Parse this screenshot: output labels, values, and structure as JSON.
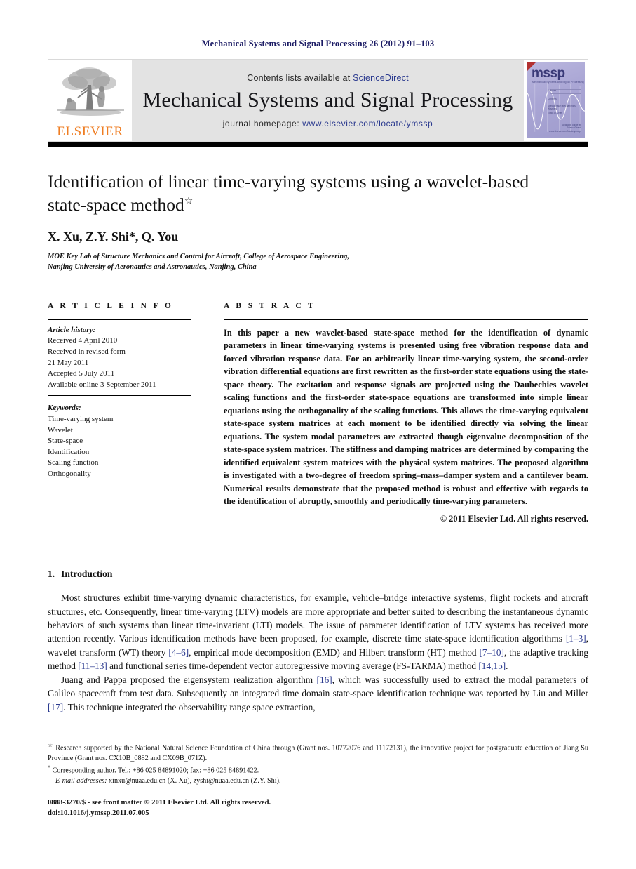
{
  "running_head": "Mechanical Systems and Signal Processing 26 (2012) 91–103",
  "masthead": {
    "publisher_logo_label": "ELSEVIER",
    "contents_prefix": "Contents lists available at",
    "contents_link": "ScienceDirect",
    "journal_title": "Mechanical Systems and Signal Processing",
    "homepage_prefix": "journal homepage:",
    "homepage_url": "www.elsevier.com/locate/ymssp",
    "cover": {
      "acronym": "mssp",
      "subtitle": "Mechanical Systems and Signal Processing",
      "line1": "Volumes",
      "line2": "Contents",
      "line3": "Special Issue: Mechatronics, Wavelets",
      "line4": "Editor-in-Chief",
      "footer1": "Available online at",
      "footer2": "ScienceDirect",
      "footer3": "www.elsevier.com/locate/ymssp"
    }
  },
  "article": {
    "title": "Identification of linear time-varying systems using a wavelet-based state-space method",
    "title_footnote_mark": "☆",
    "authors": "X. Xu, Z.Y. Shi*, Q. You",
    "affiliation_line1": "MOE Key Lab of Structure Mechanics and Control for Aircraft, College of Aerospace Engineering,",
    "affiliation_line2": "Nanjing University of Aeronautics and Astronautics, Nanjing, China"
  },
  "article_info": {
    "heading": "A R T I C L E   I N F O",
    "history_label": "Article history:",
    "history": [
      "Received 4 April 2010",
      "Received in revised form",
      "21 May 2011",
      "Accepted 5 July 2011",
      "Available online 3 September 2011"
    ],
    "keywords_label": "Keywords:",
    "keywords": [
      "Time-varying system",
      "Wavelet",
      "State-space",
      "Identification",
      "Scaling function",
      "Orthogonality"
    ]
  },
  "abstract": {
    "heading": "A B S T R A C T",
    "text": "In this paper a new wavelet-based state-space method for the identification of dynamic parameters in linear time-varying systems is presented using free vibration response data and forced vibration response data. For an arbitrarily linear time-varying system, the second-order vibration differential equations are first rewritten as the first-order state equations using the state-space theory. The excitation and response signals are projected using the Daubechies wavelet scaling functions and the first-order state-space equations are transformed into simple linear equations using the orthogonality of the scaling functions. This allows the time-varying equivalent state-space system matrices at each moment to be identified directly via solving the linear equations. The system modal parameters are extracted though eigenvalue decomposition of the state-space system matrices. The stiffness and damping matrices are determined by comparing the identified equivalent system matrices with the physical system matrices. The proposed algorithm is investigated with a two-degree of freedom spring–mass–damper system and a cantilever beam. Numerical results demonstrate that the proposed method is robust and effective with regards to the identification of abruptly, smoothly and periodically time-varying parameters.",
    "copyright": "© 2011 Elsevier Ltd. All rights reserved."
  },
  "body": {
    "section_number": "1.",
    "section_title": "Introduction",
    "para1_a": "Most structures exhibit time-varying dynamic characteristics, for example, vehicle–bridge interactive systems, flight rockets and aircraft structures, etc. Consequently, linear time-varying (LTV) models are more appropriate and better suited to describing the instantaneous dynamic behaviors of such systems than linear time-invariant (LTI) models. The issue of parameter identification of LTV systems has received more attention recently. Various identification methods have been proposed, for example, discrete time state-space identification algorithms ",
    "cite1": "[1–3]",
    "para1_b": ", wavelet transform (WT) theory ",
    "cite2": "[4–6]",
    "para1_c": ", empirical mode decomposition (EMD) and Hilbert transform (HT) method ",
    "cite3": "[7–10]",
    "para1_d": ", the adaptive tracking method ",
    "cite4": "[11–13]",
    "para1_e": " and functional series time-dependent vector autoregressive moving average (FS-TARMA) method ",
    "cite5": "[14,15]",
    "para1_f": ".",
    "para2_a": "Juang and Pappa proposed the eigensystem realization algorithm ",
    "cite6": "[16]",
    "para2_b": ", which was successfully used to extract the modal parameters of Galileo spacecraft from test data. Subsequently an integrated time domain state-space identification technique was reported by Liu and Miller ",
    "cite7": "[17]",
    "para2_c": ". This technique integrated the observability range space extraction,"
  },
  "footnotes": {
    "star_mark": "☆",
    "funding": "Research supported by the National Natural Science Foundation of China through (Grant nos. 10772076 and 11172131), the innovative project for postgraduate education of Jiang Su Province (Grant nos. CX10B_0882 and CX09B_071Z).",
    "corresponding_mark": "*",
    "corresponding": "Corresponding author. Tel.: +86 025 84891020; fax: +86 025 84891422.",
    "email_label": "E-mail addresses:",
    "emails": "xinxu@nuaa.edu.cn (X. Xu), zyshi@nuaa.edu.cn (Z.Y. Shi)."
  },
  "imprint": {
    "line1": "0888-3270/$ - see front matter © 2011 Elsevier Ltd. All rights reserved.",
    "line2": "doi:10.1016/j.ymssp.2011.07.005"
  }
}
